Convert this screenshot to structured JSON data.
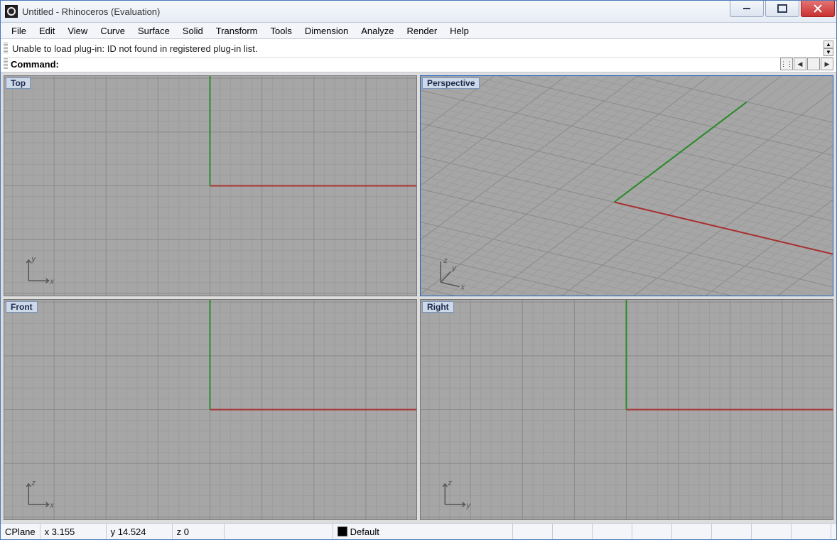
{
  "titlebar": {
    "title": "Untitled - Rhinoceros (Evaluation)"
  },
  "menubar": {
    "items": [
      "File",
      "Edit",
      "View",
      "Curve",
      "Surface",
      "Solid",
      "Transform",
      "Tools",
      "Dimension",
      "Analyze",
      "Render",
      "Help"
    ]
  },
  "command": {
    "history_line": "Unable to load plug-in: ID not found in registered plug-in list.",
    "prompt": "Command:",
    "nav": {
      "opts": "⋮⋮",
      "left": "◀",
      "sep": "",
      "right": "▶"
    }
  },
  "viewports": {
    "top_left": {
      "label": "Top",
      "axes": "xy"
    },
    "top_right": {
      "label": "Perspective",
      "axes": "xyz",
      "active": true
    },
    "bottom_left": {
      "label": "Front",
      "axes": "xz"
    },
    "bottom_right": {
      "label": "Right",
      "axes": "yz"
    }
  },
  "statusbar": {
    "cplane": "CPlane",
    "x": "x 3.155",
    "y": "y 14.524",
    "z": "z 0",
    "layer": "Default"
  }
}
